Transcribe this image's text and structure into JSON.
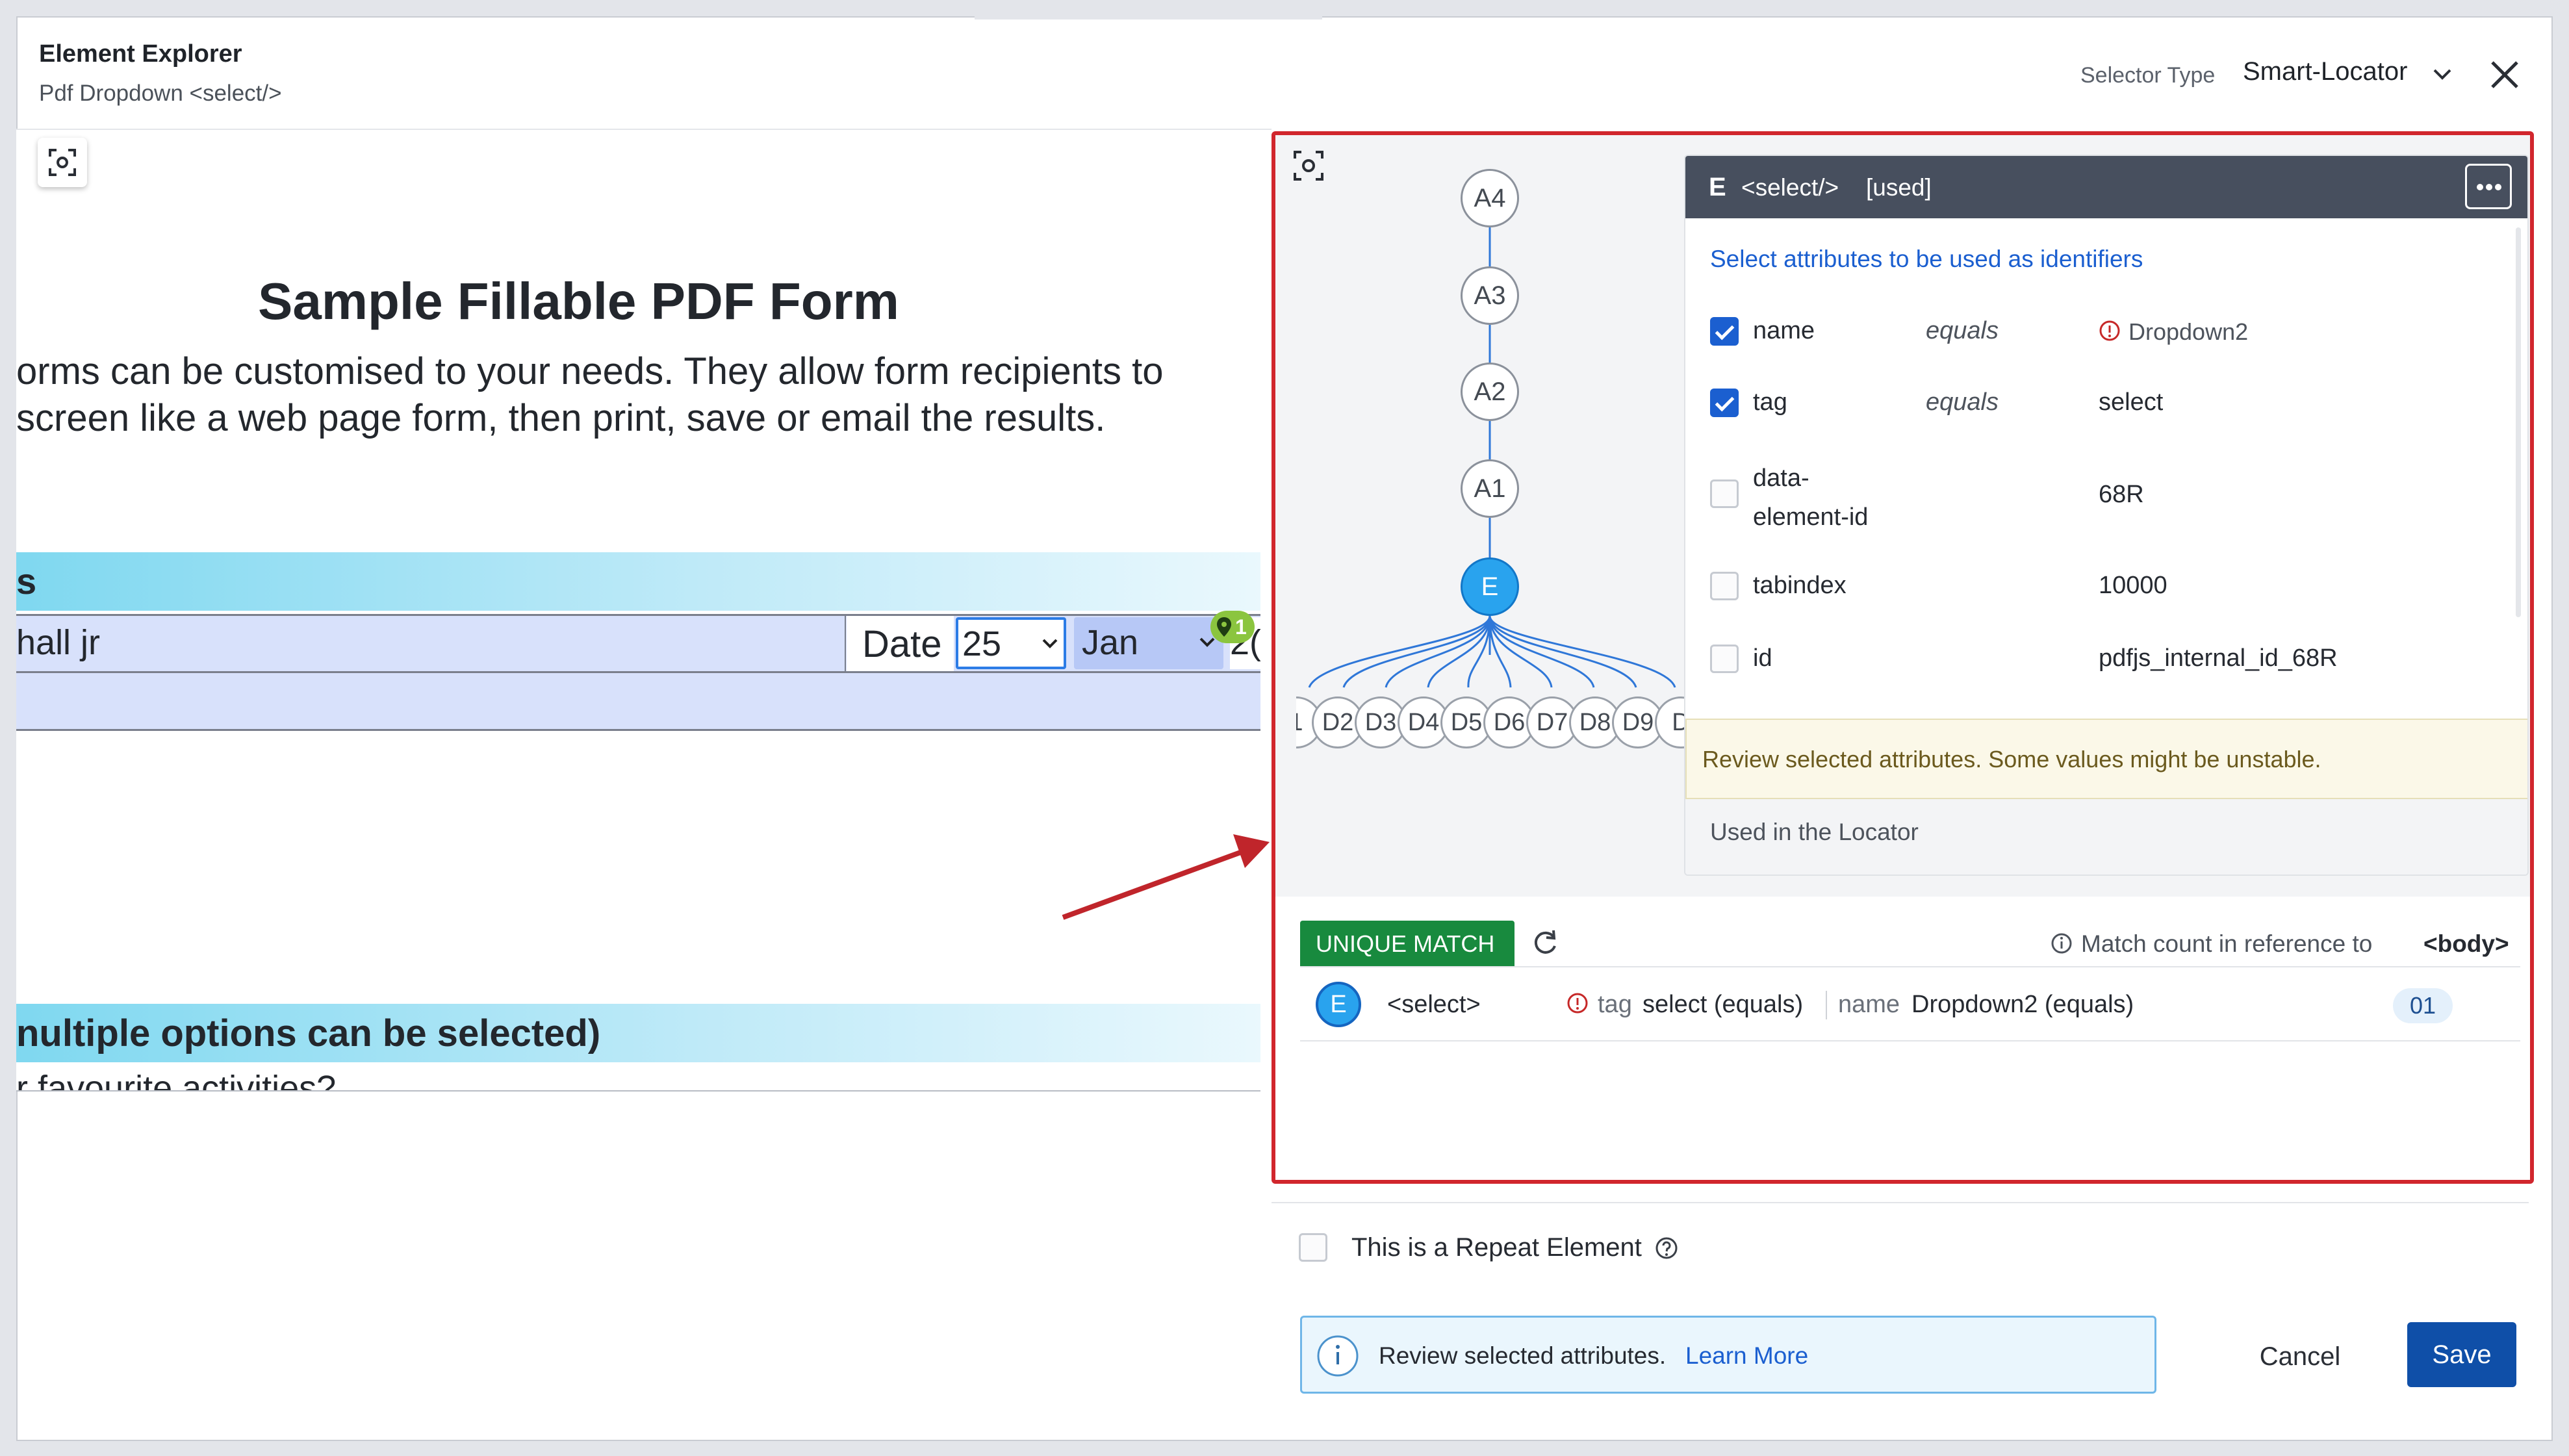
{
  "header": {
    "title": "Element Explorer",
    "subtitle": "Pdf Dropdown <select/>",
    "selector_type_label": "Selector Type",
    "selector_type_value": "Smart-Locator"
  },
  "pdf": {
    "heading": "Sample Fillable PDF Form",
    "line1": "orms  can  be  customised  to  your  needs.  They  allow  form  recipients  to",
    "line2": "screen like a web page form, then print, save or email the results.",
    "band1_text": "s",
    "name_value": "hall jr",
    "date_label": "Date",
    "day_value": "25",
    "month_value": "Jan",
    "year_fragment": "2(",
    "pin_badge": "1",
    "band2_text": "nultiple options can be selected)",
    "cut_line": "r favourite activities?"
  },
  "tree": {
    "ancestors": [
      "A4",
      "A3",
      "A2",
      "A1"
    ],
    "element": "E",
    "children": [
      "1",
      "D2",
      "D3",
      "D4",
      "D5",
      "D6",
      "D7",
      "D8",
      "D9",
      "D"
    ]
  },
  "attributes_card": {
    "badge": "E",
    "tag": "<select/>",
    "status": "[used]",
    "hint": "Select attributes to be used as identifiers",
    "rows": [
      {
        "name": "name",
        "op": "equals",
        "value": "Dropdown2",
        "checked": true,
        "warn": true
      },
      {
        "name": "tag",
        "op": "equals",
        "value": "select",
        "checked": true,
        "warn": false
      },
      {
        "name": "data-\nelement-id",
        "op": "",
        "value": "68R",
        "checked": false,
        "warn": false
      },
      {
        "name": "tabindex",
        "op": "",
        "value": "10000",
        "checked": false,
        "warn": false
      },
      {
        "name": "id",
        "op": "",
        "value": "pdfjs_internal_id_68R",
        "checked": false,
        "warn": false
      }
    ],
    "warning": "Review selected attributes. Some values might be unstable.",
    "footer": "Used in the Locator"
  },
  "match": {
    "badge": "UNIQUE MATCH",
    "count_label": "Match count in reference to",
    "count_ref": "<body>",
    "row": {
      "badge": "E",
      "tag": "<select>",
      "k1": "tag",
      "v1": "select (equals)",
      "k2": "name",
      "v2": "Dropdown2 (equals)",
      "count": "01"
    }
  },
  "repeat": {
    "label": "This is a Repeat Element"
  },
  "info": {
    "text": "Review selected attributes.",
    "link": "Learn More"
  },
  "actions": {
    "cancel": "Cancel",
    "save": "Save"
  },
  "colors": {
    "accent_blue": "#1b5fd0",
    "save_bg": "#0f4fa8",
    "unique_match_green": "#188a3e",
    "panel_border_red": "#d1262d",
    "selected_node": "#29a3ee",
    "card_header": "#474f5e"
  }
}
